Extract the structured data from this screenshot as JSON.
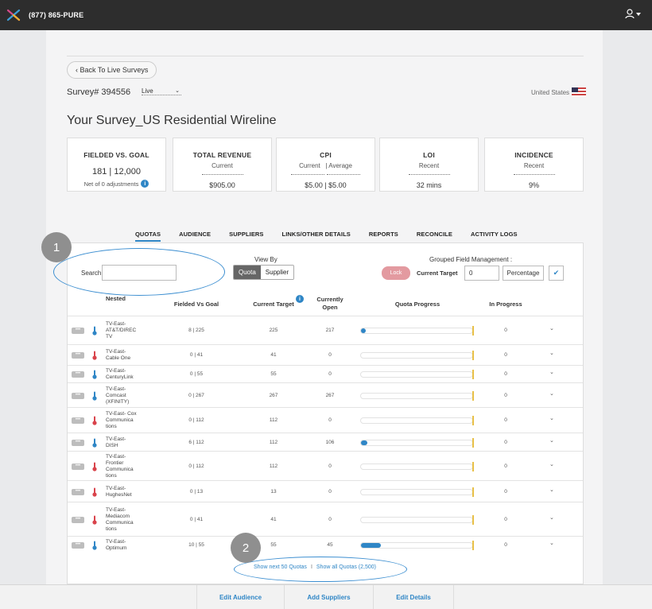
{
  "header": {
    "phone": "(877) 865-PURE"
  },
  "nav": {
    "back_label": "‹ Back To Live Surveys"
  },
  "survey": {
    "id_label": "Survey# 394556",
    "status": "Live",
    "country": "United States",
    "title": "Your Survey_US Residential Wireline"
  },
  "stats": {
    "fielded": {
      "title": "FIELDED VS. GOAL",
      "value": "181 | 12,000",
      "note": "Net of 0 adjustments"
    },
    "revenue": {
      "title": "TOTAL REVENUE",
      "sub": "Current",
      "value": "$905.00"
    },
    "cpi": {
      "title": "CPI",
      "sub_current": "Current",
      "sub_sep": "|",
      "sub_average": "Average",
      "value": "$5.00 | $5.00"
    },
    "loi": {
      "title": "LOI",
      "sub": "Recent",
      "value": "32 mins"
    },
    "incidence": {
      "title": "INCIDENCE",
      "sub": "Recent",
      "value": "9%"
    }
  },
  "tabs": [
    "QUOTAS",
    "AUDIENCE",
    "SUPPLIERS",
    "LINKS/OTHER DETAILS",
    "REPORTS",
    "RECONCILE",
    "ACTIVITY LOGS"
  ],
  "steps": {
    "one": "1",
    "two": "2"
  },
  "controls": {
    "search_label": "Search",
    "search_value": "",
    "view_by_label": "View By",
    "view_quota": "Quota",
    "view_supplier": "Supplier",
    "grouped_label": "Grouped Field Management :",
    "lock_label": "Lock",
    "current_target_label": "Current Target",
    "current_target_value": "0",
    "percentage_label": "Percentage",
    "apply_icon": "check-icon"
  },
  "table": {
    "headers": {
      "nested": "Nested",
      "fielded": "Fielded Vs Goal",
      "target": "Current Target",
      "open_line1": "Currently",
      "open_line2": "Open",
      "progress": "Quota Progress",
      "in_progress": "In Progress"
    },
    "rows": [
      {
        "name_lines": [
          "TV-East-",
          "AT&T/DIREC",
          "TV"
        ],
        "fielded": "8 | 225",
        "target": "225",
        "open": "217",
        "progress": 0.036,
        "in_progress": "0",
        "status": "blue"
      },
      {
        "name_lines": [
          "TV-East-",
          "Cable One"
        ],
        "fielded": "0 | 41",
        "target": "41",
        "open": "0",
        "progress": 0,
        "in_progress": "0",
        "status": "red"
      },
      {
        "name_lines": [
          "TV-East-",
          "CenturyLink"
        ],
        "fielded": "0 | 55",
        "target": "55",
        "open": "0",
        "progress": 0,
        "in_progress": "0",
        "status": "blue"
      },
      {
        "name_lines": [
          "TV-East-",
          "Comcast",
          "(XFINITY)"
        ],
        "fielded": "0 | 267",
        "target": "267",
        "open": "267",
        "progress": 0,
        "in_progress": "0",
        "status": "blue"
      },
      {
        "name_lines": [
          "TV-East- Cox",
          "Communica",
          "tions"
        ],
        "fielded": "0 | 112",
        "target": "112",
        "open": "0",
        "progress": 0,
        "in_progress": "0",
        "status": "red"
      },
      {
        "name_lines": [
          "TV-East-",
          "DISH"
        ],
        "fielded": "6 | 112",
        "target": "112",
        "open": "106",
        "progress": 0.054,
        "in_progress": "0",
        "status": "blue"
      },
      {
        "name_lines": [
          "TV-East-",
          "Frontier",
          "Communica",
          "tions"
        ],
        "fielded": "0 | 112",
        "target": "112",
        "open": "0",
        "progress": 0,
        "in_progress": "0",
        "status": "red"
      },
      {
        "name_lines": [
          "TV-East-",
          "HughesNet"
        ],
        "fielded": "0 | 13",
        "target": "13",
        "open": "0",
        "progress": 0,
        "in_progress": "0",
        "status": "red"
      },
      {
        "name_lines": [
          "TV-East-",
          "Mediacom",
          "Communica",
          "tions"
        ],
        "fielded": "0 | 41",
        "target": "41",
        "open": "0",
        "progress": 0,
        "in_progress": "0",
        "status": "red"
      },
      {
        "name_lines": [
          "TV-East-",
          "Optimum"
        ],
        "fielded": "10 | 55",
        "target": "55",
        "open": "45",
        "progress": 0.18,
        "in_progress": "0",
        "status": "blue"
      }
    ]
  },
  "pagination": {
    "next_label": "Show next 50 Quotas",
    "sep": "I",
    "all_label": "Show all Quotas (2,500)"
  },
  "footer": {
    "edit_audience": "Edit Audience",
    "add_suppliers": "Add Suppliers",
    "edit_details": "Edit Details"
  },
  "colors": {
    "accent": "#2f86c6",
    "status_blue": "#2f86c6",
    "status_red": "#d9434b",
    "lock": "#e39aa0",
    "target_marker": "#e8c048"
  }
}
